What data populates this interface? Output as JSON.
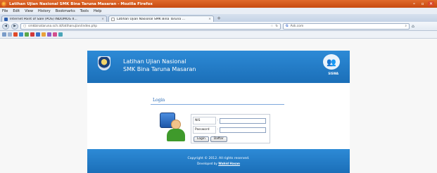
{
  "window": {
    "title": "Latihan Ujian Nasional SMK Bina Taruna Masaran - Mozilla Firefox"
  },
  "menu": [
    "File",
    "Edit",
    "View",
    "History",
    "Bookmarks",
    "Tools",
    "Help"
  ],
  "tabs": [
    {
      "label": "Internet Point of Sale (POS) INDOMOG II..."
    },
    {
      "label": "Latihan Ujian Nasional SMK Bina Taruna ..."
    }
  ],
  "nav": {
    "url": "smkbinataruna.sch.id/latihanujian/index.php",
    "search_placeholder": "Ask.com"
  },
  "site": {
    "brand_line1": "Latihan Ujian Nasional",
    "brand_line2": "SMK Bina Taruna Masaran",
    "people_caption": "SISWA",
    "login_heading": "Login",
    "form": {
      "nis_label": "NIS",
      "password_label": "Password",
      "colon": ":",
      "login_button": "Login",
      "register_button": "Daftar"
    },
    "footer_line1": "Copyright © 2012. All rights reserved.",
    "footer_prefix": "Developed by ",
    "footer_author": "Wahid Hasan"
  },
  "colors": {
    "header_blue": "#1b6fb8",
    "title_orange": "#c74a10"
  }
}
